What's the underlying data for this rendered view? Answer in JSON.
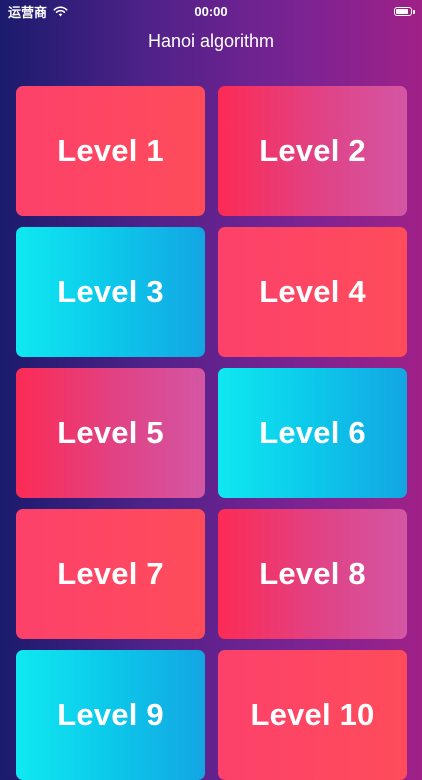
{
  "status_bar": {
    "carrier": "运营商",
    "time": "00:00",
    "wifi_icon": "wifi-icon",
    "battery_icon": "battery-icon"
  },
  "title": "Hanoi algorithm",
  "levels": [
    {
      "label": "Level 1",
      "style": "red"
    },
    {
      "label": "Level 2",
      "style": "pink"
    },
    {
      "label": "Level 3",
      "style": "cyan"
    },
    {
      "label": "Level 4",
      "style": "red"
    },
    {
      "label": "Level 5",
      "style": "pink"
    },
    {
      "label": "Level 6",
      "style": "cyan"
    },
    {
      "label": "Level 7",
      "style": "red"
    },
    {
      "label": "Level 8",
      "style": "pink"
    },
    {
      "label": "Level 9",
      "style": "cyan"
    },
    {
      "label": "Level 10",
      "style": "red"
    }
  ],
  "colors": {
    "background_left": "#1b1b6d",
    "background_right": "#a02188",
    "card_red": "#fd416b",
    "card_pink": "#e04386",
    "card_cyan": "#0cc8ea"
  }
}
